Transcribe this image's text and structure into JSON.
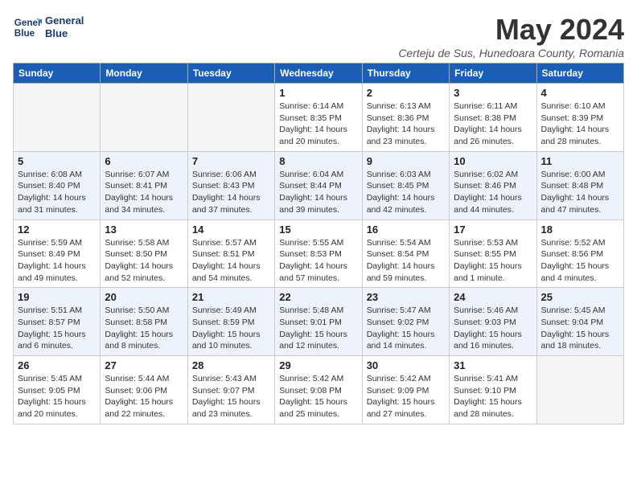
{
  "header": {
    "logo_line1": "General",
    "logo_line2": "Blue",
    "month_title": "May 2024",
    "subtitle": "Certeju de Sus, Hunedoara County, Romania"
  },
  "weekdays": [
    "Sunday",
    "Monday",
    "Tuesday",
    "Wednesday",
    "Thursday",
    "Friday",
    "Saturday"
  ],
  "weeks": [
    [
      {
        "day": "",
        "info": ""
      },
      {
        "day": "",
        "info": ""
      },
      {
        "day": "",
        "info": ""
      },
      {
        "day": "1",
        "info": "Sunrise: 6:14 AM\nSunset: 8:35 PM\nDaylight: 14 hours\nand 20 minutes."
      },
      {
        "day": "2",
        "info": "Sunrise: 6:13 AM\nSunset: 8:36 PM\nDaylight: 14 hours\nand 23 minutes."
      },
      {
        "day": "3",
        "info": "Sunrise: 6:11 AM\nSunset: 8:38 PM\nDaylight: 14 hours\nand 26 minutes."
      },
      {
        "day": "4",
        "info": "Sunrise: 6:10 AM\nSunset: 8:39 PM\nDaylight: 14 hours\nand 28 minutes."
      }
    ],
    [
      {
        "day": "5",
        "info": "Sunrise: 6:08 AM\nSunset: 8:40 PM\nDaylight: 14 hours\nand 31 minutes."
      },
      {
        "day": "6",
        "info": "Sunrise: 6:07 AM\nSunset: 8:41 PM\nDaylight: 14 hours\nand 34 minutes."
      },
      {
        "day": "7",
        "info": "Sunrise: 6:06 AM\nSunset: 8:43 PM\nDaylight: 14 hours\nand 37 minutes."
      },
      {
        "day": "8",
        "info": "Sunrise: 6:04 AM\nSunset: 8:44 PM\nDaylight: 14 hours\nand 39 minutes."
      },
      {
        "day": "9",
        "info": "Sunrise: 6:03 AM\nSunset: 8:45 PM\nDaylight: 14 hours\nand 42 minutes."
      },
      {
        "day": "10",
        "info": "Sunrise: 6:02 AM\nSunset: 8:46 PM\nDaylight: 14 hours\nand 44 minutes."
      },
      {
        "day": "11",
        "info": "Sunrise: 6:00 AM\nSunset: 8:48 PM\nDaylight: 14 hours\nand 47 minutes."
      }
    ],
    [
      {
        "day": "12",
        "info": "Sunrise: 5:59 AM\nSunset: 8:49 PM\nDaylight: 14 hours\nand 49 minutes."
      },
      {
        "day": "13",
        "info": "Sunrise: 5:58 AM\nSunset: 8:50 PM\nDaylight: 14 hours\nand 52 minutes."
      },
      {
        "day": "14",
        "info": "Sunrise: 5:57 AM\nSunset: 8:51 PM\nDaylight: 14 hours\nand 54 minutes."
      },
      {
        "day": "15",
        "info": "Sunrise: 5:55 AM\nSunset: 8:53 PM\nDaylight: 14 hours\nand 57 minutes."
      },
      {
        "day": "16",
        "info": "Sunrise: 5:54 AM\nSunset: 8:54 PM\nDaylight: 14 hours\nand 59 minutes."
      },
      {
        "day": "17",
        "info": "Sunrise: 5:53 AM\nSunset: 8:55 PM\nDaylight: 15 hours\nand 1 minute."
      },
      {
        "day": "18",
        "info": "Sunrise: 5:52 AM\nSunset: 8:56 PM\nDaylight: 15 hours\nand 4 minutes."
      }
    ],
    [
      {
        "day": "19",
        "info": "Sunrise: 5:51 AM\nSunset: 8:57 PM\nDaylight: 15 hours\nand 6 minutes."
      },
      {
        "day": "20",
        "info": "Sunrise: 5:50 AM\nSunset: 8:58 PM\nDaylight: 15 hours\nand 8 minutes."
      },
      {
        "day": "21",
        "info": "Sunrise: 5:49 AM\nSunset: 8:59 PM\nDaylight: 15 hours\nand 10 minutes."
      },
      {
        "day": "22",
        "info": "Sunrise: 5:48 AM\nSunset: 9:01 PM\nDaylight: 15 hours\nand 12 minutes."
      },
      {
        "day": "23",
        "info": "Sunrise: 5:47 AM\nSunset: 9:02 PM\nDaylight: 15 hours\nand 14 minutes."
      },
      {
        "day": "24",
        "info": "Sunrise: 5:46 AM\nSunset: 9:03 PM\nDaylight: 15 hours\nand 16 minutes."
      },
      {
        "day": "25",
        "info": "Sunrise: 5:45 AM\nSunset: 9:04 PM\nDaylight: 15 hours\nand 18 minutes."
      }
    ],
    [
      {
        "day": "26",
        "info": "Sunrise: 5:45 AM\nSunset: 9:05 PM\nDaylight: 15 hours\nand 20 minutes."
      },
      {
        "day": "27",
        "info": "Sunrise: 5:44 AM\nSunset: 9:06 PM\nDaylight: 15 hours\nand 22 minutes."
      },
      {
        "day": "28",
        "info": "Sunrise: 5:43 AM\nSunset: 9:07 PM\nDaylight: 15 hours\nand 23 minutes."
      },
      {
        "day": "29",
        "info": "Sunrise: 5:42 AM\nSunset: 9:08 PM\nDaylight: 15 hours\nand 25 minutes."
      },
      {
        "day": "30",
        "info": "Sunrise: 5:42 AM\nSunset: 9:09 PM\nDaylight: 15 hours\nand 27 minutes."
      },
      {
        "day": "31",
        "info": "Sunrise: 5:41 AM\nSunset: 9:10 PM\nDaylight: 15 hours\nand 28 minutes."
      },
      {
        "day": "",
        "info": ""
      }
    ]
  ]
}
